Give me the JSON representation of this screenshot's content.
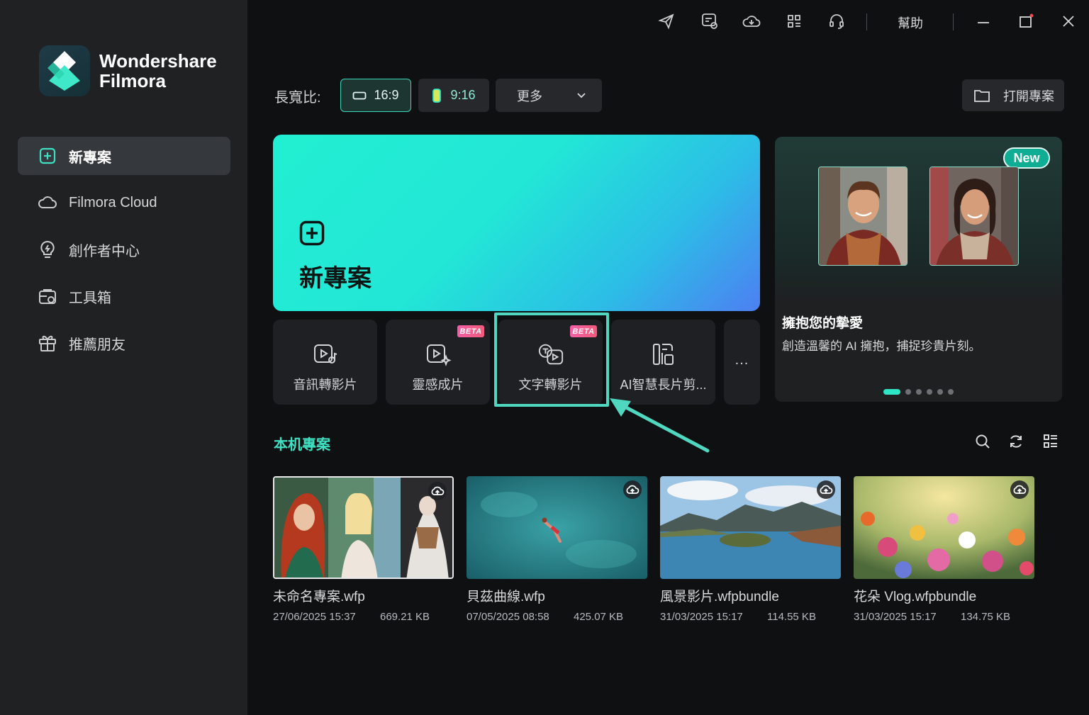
{
  "app": {
    "brand_line1": "Wondershare",
    "brand_line2": "Filmora"
  },
  "sidebar": {
    "items": [
      {
        "label": "新專案",
        "icon": "new-project-icon",
        "active": true
      },
      {
        "label": "Filmora Cloud",
        "icon": "cloud-icon",
        "active": false
      },
      {
        "label": "創作者中心",
        "icon": "lightbulb-icon",
        "active": false
      },
      {
        "label": "工具箱",
        "icon": "toolbox-icon",
        "active": false
      },
      {
        "label": "推薦朋友",
        "icon": "gift-icon",
        "active": false
      }
    ]
  },
  "titlebar": {
    "icons": [
      "send-feedback-icon",
      "messages-icon",
      "cloud-sync-icon",
      "apps-grid-icon",
      "support-headset-icon"
    ],
    "help_label": "幫助",
    "window_controls": [
      "minimize-icon",
      "maximize-icon",
      "close-icon"
    ]
  },
  "aspect": {
    "label": "長寬比:",
    "ratio_16_9": "16:9",
    "ratio_9_16": "9:16",
    "more_label": "更多",
    "selected": "16:9"
  },
  "open_project_label": "打開專案",
  "hero": {
    "title": "新專案"
  },
  "tools": [
    {
      "label": "音訊轉影片",
      "icon": "audio-to-video-icon",
      "beta": false
    },
    {
      "label": "靈感成片",
      "icon": "inspiration-video-icon",
      "beta": true
    },
    {
      "label": "文字轉影片",
      "icon": "text-to-video-icon",
      "beta": true
    },
    {
      "label": "AI智慧長片剪...",
      "icon": "ai-long-video-cut-icon",
      "beta": false
    }
  ],
  "beta_label": "BETA",
  "more_tools_label": "...",
  "promo": {
    "badge": "New",
    "title": "擁抱您的摯愛",
    "description": "創造溫馨的 AI 擁抱，捕捉珍貴片刻。",
    "dots_total": 6,
    "dots_active": 1
  },
  "local_projects": {
    "title": "本机專案",
    "tool_icons": [
      "search-icon",
      "refresh-icon",
      "list-view-icon"
    ],
    "items": [
      {
        "name": "未命名專案.wfp",
        "date": "27/06/2025 15:37",
        "size": "669.21 KB"
      },
      {
        "name": "貝茲曲線.wfp",
        "date": "07/05/2025 08:58",
        "size": "425.07 KB"
      },
      {
        "name": "風景影片.wfpbundle",
        "date": "31/03/2025 15:17",
        "size": "114.55 KB"
      },
      {
        "name": "花朵 Vlog.wfpbundle",
        "date": "31/03/2025 15:17",
        "size": "134.75 KB"
      }
    ]
  },
  "colors": {
    "accent": "#3fe0c2",
    "sidebar_bg": "#1f2123",
    "main_bg": "#0f1012",
    "highlight_box": "#4fd8bf",
    "beta_badge": "#f25fa6"
  }
}
